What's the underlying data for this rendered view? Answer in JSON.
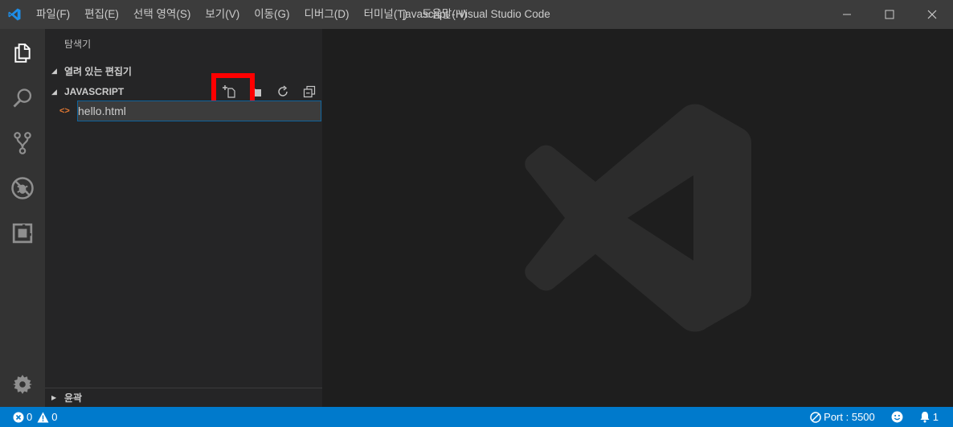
{
  "titlebar": {
    "window_title": "javascript - Visual Studio Code",
    "menu": [
      "파일(F)",
      "편집(E)",
      "선택 영역(S)",
      "보기(V)",
      "이동(G)",
      "디버그(D)",
      "터미널(T)",
      "도움말(H)"
    ]
  },
  "activitybar": {
    "items": [
      "explorer-icon",
      "search-icon",
      "source-control-icon",
      "debug-icon",
      "extensions-icon"
    ],
    "bottom": "gear-icon"
  },
  "sidebar": {
    "title": "탐색기",
    "open_editors": "열려 있는 편집기",
    "folder": "JAVASCRIPT",
    "actions": [
      "new-file-icon",
      "new-folder-icon",
      "refresh-icon",
      "collapse-all-icon"
    ],
    "new_file_value": "hello.html",
    "outline": "윤곽"
  },
  "statusbar": {
    "errors": "0",
    "warnings": "0",
    "port": "Port : 5500",
    "notifications": "1"
  },
  "colors": {
    "accent": "#007acc",
    "highlight": "#ff0000",
    "html_icon": "#e37933"
  }
}
